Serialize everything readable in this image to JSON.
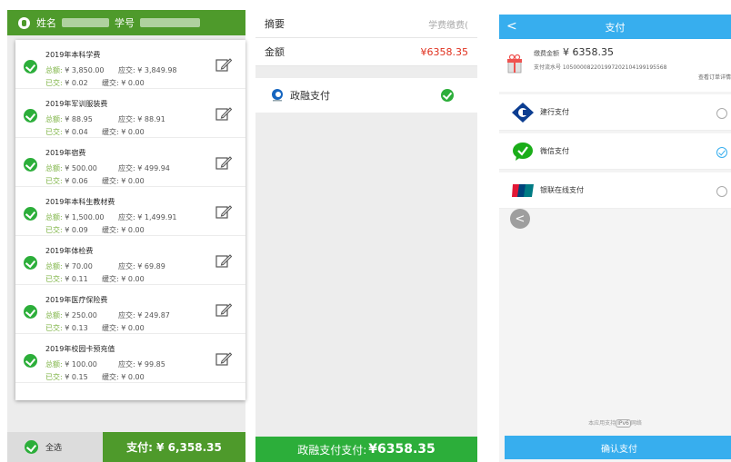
{
  "screen1": {
    "header": {
      "name_label": "姓名",
      "student_id_label": "学号"
    },
    "fees": [
      {
        "title": "2019年本科学费",
        "total_label": "总额:",
        "total": "¥ 3,850.00",
        "due_label": "应交:",
        "due": "¥ 3,849.98",
        "paid_label": "已交:",
        "paid": "¥ 0.02",
        "deferred_label": "缓交:",
        "deferred": "¥ 0.00"
      },
      {
        "title": "2019年军训服装费",
        "total_label": "总额:",
        "total": "¥ 88.95",
        "due_label": "应交:",
        "due": "¥ 88.91",
        "paid_label": "已交:",
        "paid": "¥ 0.04",
        "deferred_label": "缓交:",
        "deferred": "¥ 0.00"
      },
      {
        "title": "2019年宿费",
        "total_label": "总额:",
        "total": "¥ 500.00",
        "due_label": "应交:",
        "due": "¥ 499.94",
        "paid_label": "已交:",
        "paid": "¥ 0.06",
        "deferred_label": "缓交:",
        "deferred": "¥ 0.00"
      },
      {
        "title": "2019年本科生教材费",
        "total_label": "总额:",
        "total": "¥ 1,500.00",
        "due_label": "应交:",
        "due": "¥ 1,499.91",
        "paid_label": "已交:",
        "paid": "¥ 0.09",
        "deferred_label": "缓交:",
        "deferred": "¥ 0.00"
      },
      {
        "title": "2019年体检费",
        "total_label": "总额:",
        "total": "¥ 70.00",
        "due_label": "应交:",
        "due": "¥ 69.89",
        "paid_label": "已交:",
        "paid": "¥ 0.11",
        "deferred_label": "缓交:",
        "deferred": "¥ 0.00"
      },
      {
        "title": "2019年医疗保险费",
        "total_label": "总额:",
        "total": "¥ 250.00",
        "due_label": "应交:",
        "due": "¥ 249.87",
        "paid_label": "已交:",
        "paid": "¥ 0.13",
        "deferred_label": "缓交:",
        "deferred": "¥ 0.00"
      },
      {
        "title": "2019年校园卡预充值",
        "total_label": "总额:",
        "total": "¥ 100.00",
        "due_label": "应交:",
        "due": "¥ 99.85",
        "paid_label": "已交:",
        "paid": "¥ 0.15",
        "deferred_label": "缓交:",
        "deferred": "¥ 0.00"
      }
    ],
    "footer": {
      "select_all": "全选",
      "pay_button": "支付: ¥ 6,358.35"
    }
  },
  "screen2": {
    "summary_label": "摘要",
    "summary_value": "学费缴费(",
    "amount_label": "金额",
    "amount_value": "¥6358.35",
    "payment_method": "政融支付",
    "pay_button": "政融支付支付:",
    "pay_amount": "¥6358.35"
  },
  "screen3": {
    "title": "支付",
    "back_glyph": "<",
    "amount_label": "缴费金额",
    "amount": "¥ 6358.35",
    "serial": "支付流水号 1050000822019972021041991955​68",
    "view_order": "查看订单详情",
    "options": [
      {
        "label": "建行支付",
        "icon": "ccb-icon",
        "selected": false
      },
      {
        "label": "微信支付",
        "icon": "wechat-pay-icon",
        "selected": true
      },
      {
        "label": "银联在线支付",
        "icon": "unionpay-icon",
        "selected": false
      }
    ],
    "ipv6_text_pre": "本应用支持",
    "ipv6_badge": "IPv6",
    "ipv6_text_post": "网络",
    "confirm_button": "确认支付"
  },
  "colors": {
    "green_header": "#4e9a2b",
    "green_check": "#2cae3a",
    "blue": "#37aeee",
    "red": "#e0301e"
  }
}
